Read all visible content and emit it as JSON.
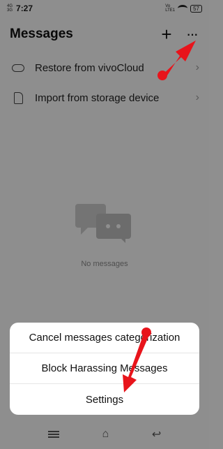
{
  "status_bar": {
    "signal_top": "4G",
    "signal_bottom": "3G",
    "time": "7:27",
    "volte_top": "Vo",
    "volte_bottom": "LTE1",
    "battery": "57"
  },
  "header": {
    "title": "Messages",
    "add_icon": "+",
    "more_icon": "···"
  },
  "options": [
    {
      "label": "Restore from vivoCloud",
      "icon": "cloud-icon"
    },
    {
      "label": "Import from storage device",
      "icon": "sd-card-icon"
    }
  ],
  "empty_state": {
    "text": "No messages"
  },
  "bottom_sheet": {
    "items": [
      "Cancel messages categorization",
      "Block Harassing Messages",
      "Settings"
    ]
  },
  "nav": {
    "menu_icon": "menu-icon",
    "home_icon": "home-icon",
    "back_icon": "back-icon"
  },
  "colors": {
    "arrow": "#e8141b",
    "sheet_bg": "#ffffff",
    "scrim": "#8f8f8f"
  }
}
